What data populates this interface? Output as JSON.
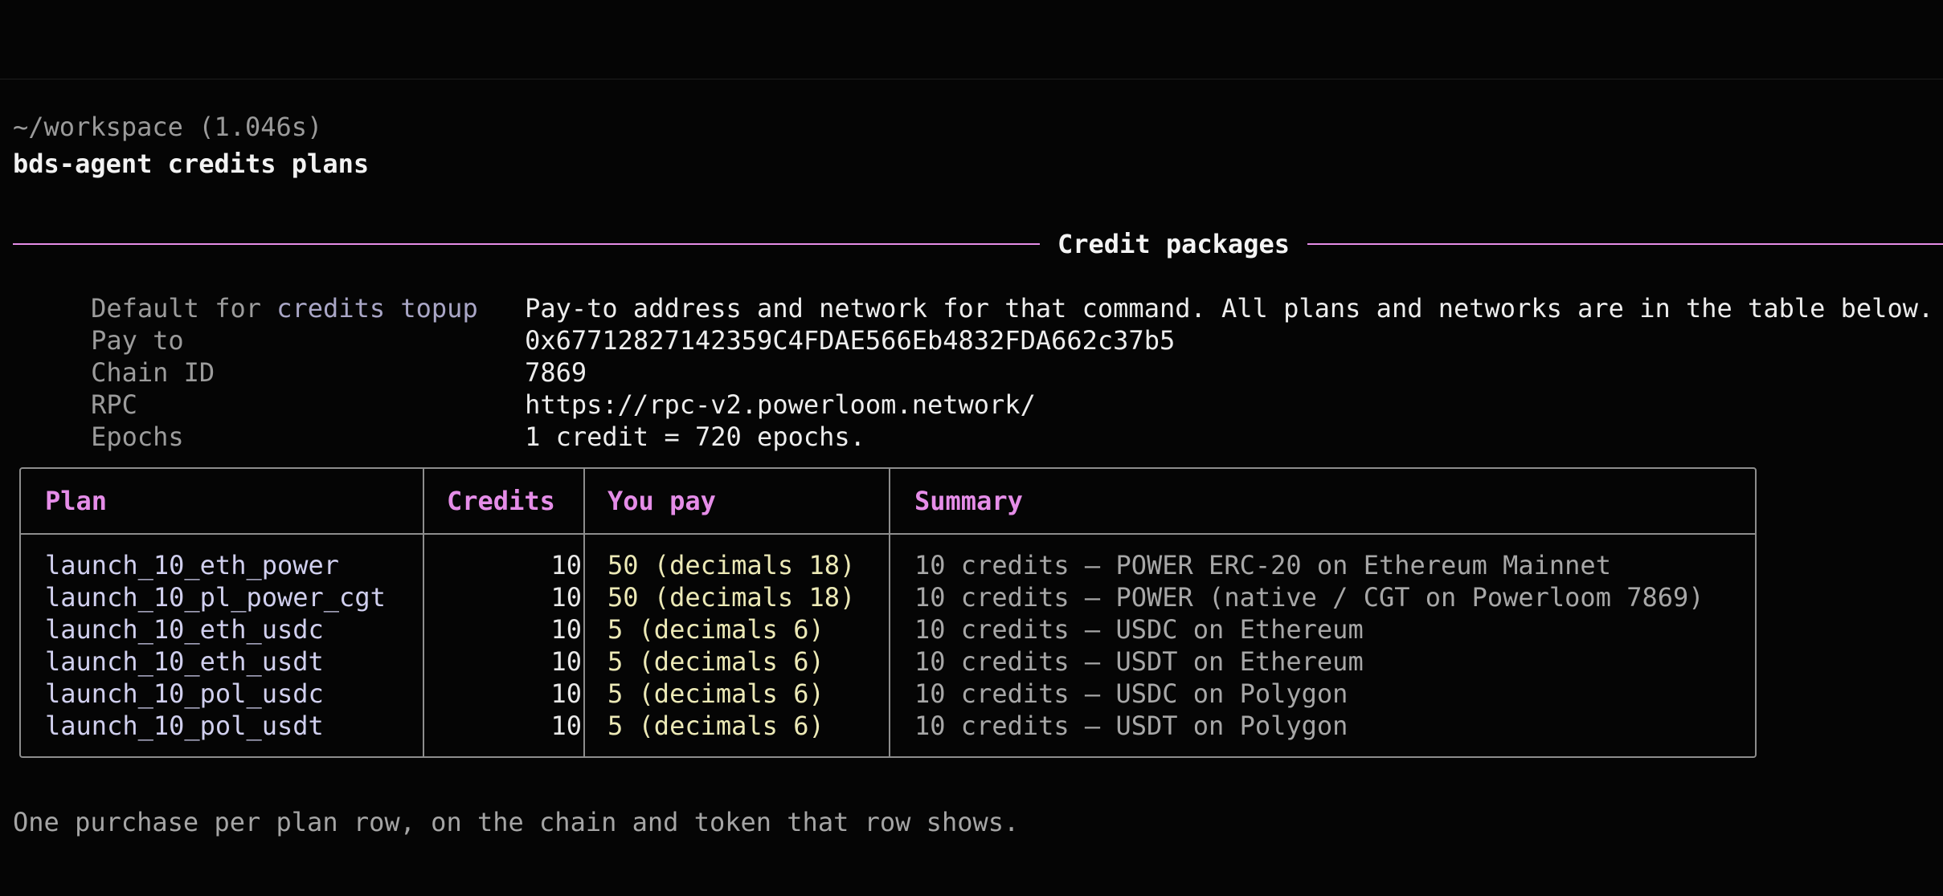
{
  "terminal": {
    "cwd_line": "~/workspace (1.046s)",
    "command": "bds-agent credits plans"
  },
  "section": {
    "title": "Credit packages"
  },
  "info": {
    "rows": [
      {
        "key_prefix": "Default for ",
        "key_highlight": "credits topup",
        "value": "Pay-to address and network for that command. All plans and networks are in the table below."
      },
      {
        "key_prefix": "Pay to",
        "key_highlight": "",
        "value": "0x67712827142359C4FDAE566Eb4832FDA662c37b5"
      },
      {
        "key_prefix": "Chain ID",
        "key_highlight": "",
        "value": "7869"
      },
      {
        "key_prefix": "RPC",
        "key_highlight": "",
        "value": "https://rpc-v2.powerloom.network/"
      },
      {
        "key_prefix": "Epochs",
        "key_highlight": "",
        "value": "1 credit = 720 epochs."
      }
    ]
  },
  "plans": {
    "headers": {
      "plan": "Plan",
      "credits": "Credits",
      "pay": "You pay",
      "summary": "Summary"
    },
    "rows": [
      {
        "plan": "launch_10_eth_power",
        "credits": "10",
        "pay": "50 (decimals 18)",
        "summary": "10 credits — POWER ERC-20 on Ethereum Mainnet"
      },
      {
        "plan": "launch_10_pl_power_cgt",
        "credits": "10",
        "pay": "50 (decimals 18)",
        "summary": "10 credits — POWER (native / CGT on Powerloom 7869)"
      },
      {
        "plan": "launch_10_eth_usdc",
        "credits": "10",
        "pay": "5 (decimals 6)",
        "summary": "10 credits — USDC on Ethereum"
      },
      {
        "plan": "launch_10_eth_usdt",
        "credits": "10",
        "pay": "5 (decimals 6)",
        "summary": "10 credits — USDT on Ethereum"
      },
      {
        "plan": "launch_10_pol_usdc",
        "credits": "10",
        "pay": "5 (decimals 6)",
        "summary": "10 credits — USDC on Polygon"
      },
      {
        "plan": "launch_10_pol_usdt",
        "credits": "10",
        "pay": "5 (decimals 6)",
        "summary": "10 credits — USDT on Polygon"
      }
    ]
  },
  "footer": {
    "note": "One purchase per plan row, on the chain and token that row shows."
  },
  "colors": {
    "background": "#050505",
    "accent": "#e58de8",
    "pay_text": "#ece9b6",
    "plan_text": "#d0cfee"
  }
}
